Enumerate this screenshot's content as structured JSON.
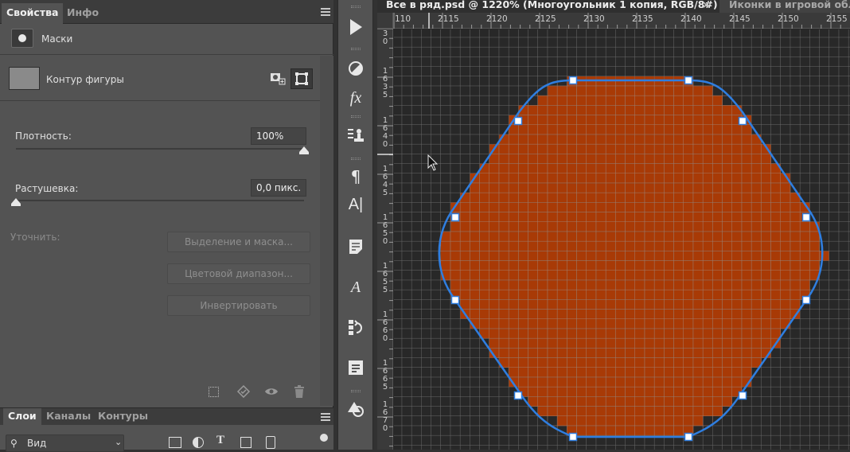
{
  "properties_panel": {
    "tabs": [
      "Свойства",
      "Инфо"
    ],
    "masks_label": "Маски",
    "shape_contour_label": "Контур фигуры",
    "density_label": "Плотность:",
    "density_value": "100%",
    "density_level": 1.0,
    "feather_label": "Растушевка:",
    "feather_value": "0,0 пикс.",
    "feather_level": 0.0,
    "refine_label": "Уточнить:",
    "select_mask_button": "Выделение и маска...",
    "color_range_button": "Цветовой диапазон...",
    "invert_button": "Инвертировать"
  },
  "layers_panel": {
    "tabs": [
      "Слои",
      "Каналы",
      "Контуры"
    ],
    "filter_kind": "Вид"
  },
  "toolbar": {
    "tools": [
      "play-icon",
      "adjustments-icon",
      "fx-icon",
      "clone-source-icon",
      "paragraph-icon",
      "character-icon",
      "notes-icon",
      "glyphs-icon",
      "history-icon",
      "libraries-icon",
      "shape-icon"
    ]
  },
  "document": {
    "active_tab": "Все в ряд.psd @ 1220% (Многоугольник 1 копия, RGB/8#)",
    "close_glyph": "×",
    "inactive_tab": "Иконки в игровой обл",
    "ruler_h_ticks": [
      "110",
      "2115",
      "2120",
      "2125",
      "2130",
      "2135",
      "2140",
      "2145",
      "2150",
      "2155"
    ],
    "ruler_v_ticks": [
      [
        "3",
        "0"
      ],
      [
        "1",
        "6",
        "3",
        "5"
      ],
      [
        "1",
        "6",
        "4",
        "0"
      ],
      [
        "1",
        "6",
        "4",
        "5"
      ],
      [
        "1",
        "6",
        "5",
        "0"
      ],
      [
        "1",
        "6",
        "5",
        "5"
      ],
      [
        "1",
        "6",
        "6",
        "0"
      ],
      [
        "1",
        "6",
        "6",
        "5"
      ],
      [
        "1",
        "6",
        "7",
        "0"
      ]
    ]
  },
  "colors": {
    "shape_fill": "#a83a06",
    "path_stroke": "#2f7ee0",
    "grid": "#6e6e6e",
    "canvas_bg": "#282828"
  }
}
